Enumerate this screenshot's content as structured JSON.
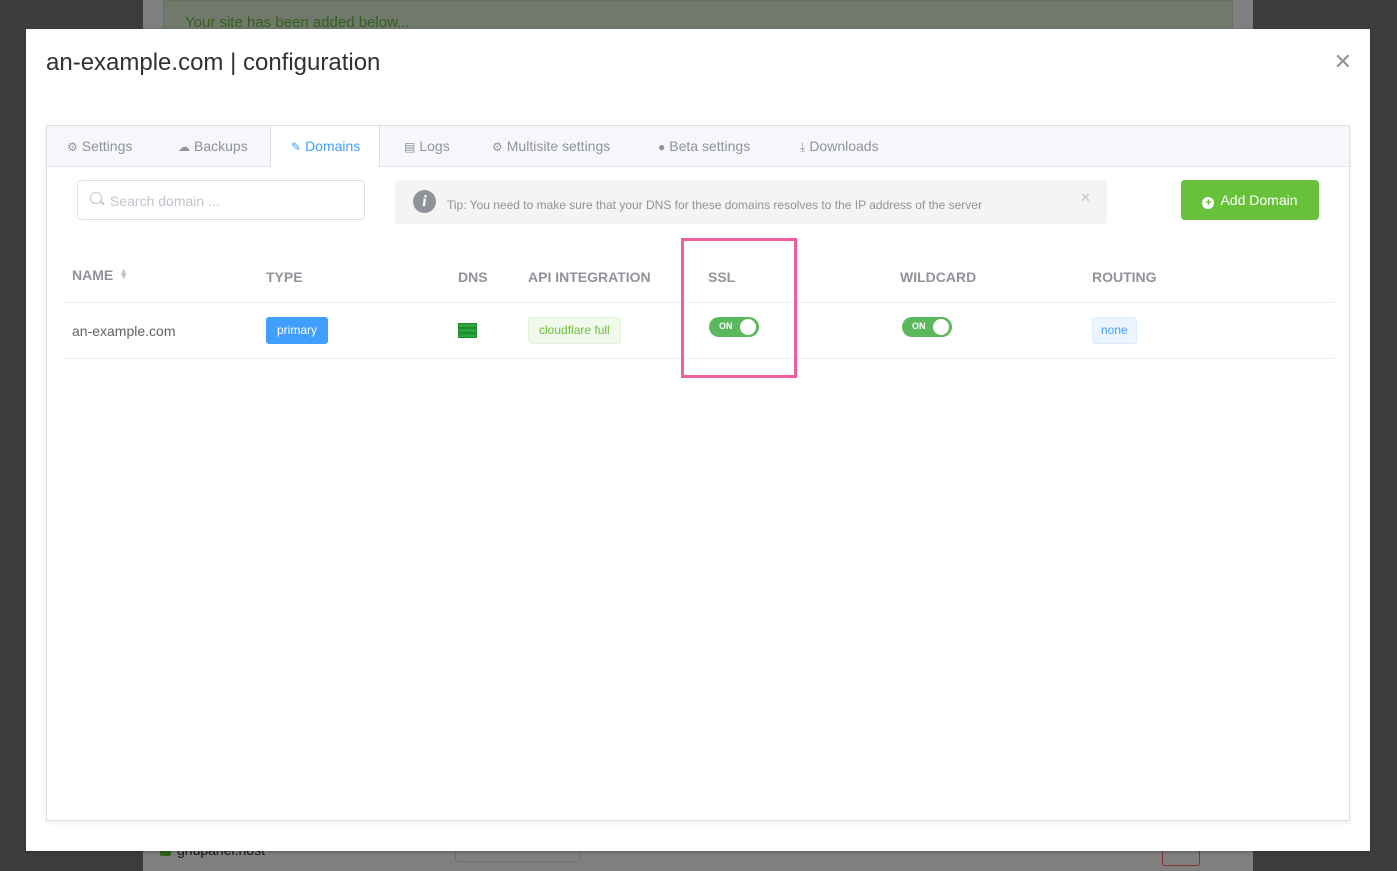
{
  "background": {
    "alert_text": "Your site has been added below...",
    "site_label": "gnupanel.host"
  },
  "dialog": {
    "title": "an-example.com | configuration",
    "close_icon": "close-icon"
  },
  "tabs": [
    {
      "label": "Settings",
      "icon": "gear-icon",
      "active": false
    },
    {
      "label": "Backups",
      "icon": "cloud-icon",
      "active": false
    },
    {
      "label": "Domains",
      "icon": "edit-icon",
      "active": true
    },
    {
      "label": "Logs",
      "icon": "document-icon",
      "active": false
    },
    {
      "label": "Multisite settings",
      "icon": "gear-icon",
      "active": false
    },
    {
      "label": "Beta settings",
      "icon": "alert-icon",
      "active": false
    },
    {
      "label": "Downloads",
      "icon": "download-icon",
      "active": false
    }
  ],
  "search": {
    "placeholder": "Search domain ...",
    "value": ""
  },
  "tip": {
    "text": "Tip: You need to make sure that your DNS for these domains resolves to the IP address of the server"
  },
  "add_button": {
    "label": "Add Domain"
  },
  "table": {
    "columns": [
      "NAME",
      "TYPE",
      "DNS",
      "API INTEGRATION",
      "SSL",
      "WILDCARD",
      "ROUTING"
    ],
    "rows": [
      {
        "name": "an-example.com",
        "type": "primary",
        "dns_icon": "server-icon",
        "api_integration": "cloudflare full",
        "ssl": "ON",
        "wildcard": "ON",
        "routing": "none"
      }
    ]
  },
  "colors": {
    "primary": "#409eff",
    "success": "#67c23a",
    "switch_on": "#5cb85c",
    "highlight": "#f0609e"
  }
}
